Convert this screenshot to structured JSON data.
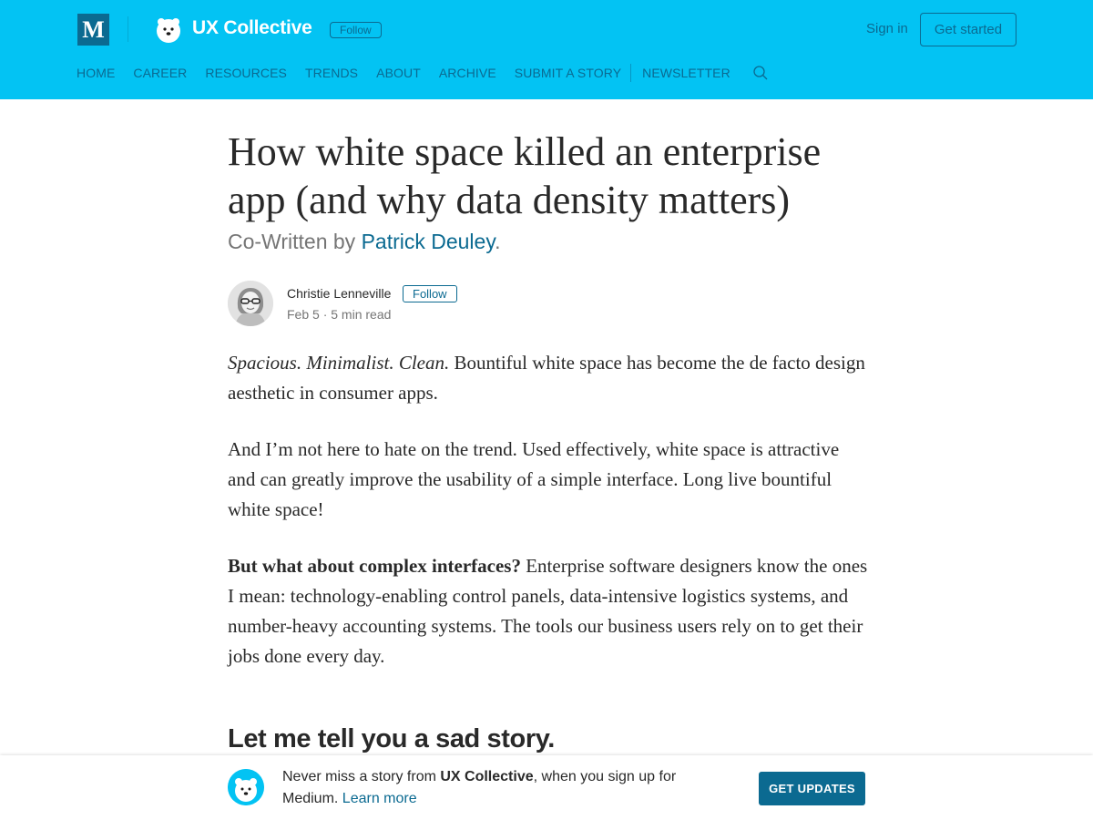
{
  "header": {
    "site_logo_letter": "M",
    "publication": "UX Collective",
    "follow_label": "Follow",
    "signin_label": "Sign in",
    "get_started_label": "Get started",
    "nav": [
      "HOME",
      "CAREER",
      "RESOURCES",
      "TRENDS",
      "ABOUT",
      "ARCHIVE",
      "SUBMIT A STORY",
      "NEWSLETTER"
    ],
    "search_icon": "search-icon"
  },
  "article": {
    "title": "How white space killed an enterprise app (and why data density matters)",
    "subtitle_prefix": "Co-Written by ",
    "subtitle_link": "Patrick Deuley",
    "subtitle_suffix": ".",
    "author": {
      "name": "Christie Lenneville",
      "follow_label": "Follow",
      "meta": "Feb 5 · 5 min read"
    },
    "p1_italic": "Spacious. Minimalist. Clean.",
    "p1_rest": " Bountiful white space has become the de facto design aesthetic in consumer apps.",
    "p2": "And I’m not here to hate on the trend. Used effectively, white space is attractive and can greatly improve the usability of a simple interface. Long live bountiful white space!",
    "p3_bold": "But what about complex interfaces?",
    "p3_rest": " Enterprise software designers know the ones I mean: technology-enabling control panels, data-intensive logistics systems, and number-heavy accounting systems. The tools our business users rely on to get their jobs done every day.",
    "section_heading": "Let me tell you a sad story."
  },
  "banner": {
    "text_prefix": "Never miss a story from ",
    "text_bold": "UX Collective",
    "text_suffix": ", when you sign up for Medium. ",
    "learn_more": "Learn more",
    "cta_label": "GET UPDATES"
  },
  "colors": {
    "header_bg": "#03c3f3",
    "accent": "#0b6a91",
    "text": "#292929",
    "muted": "#757575"
  }
}
